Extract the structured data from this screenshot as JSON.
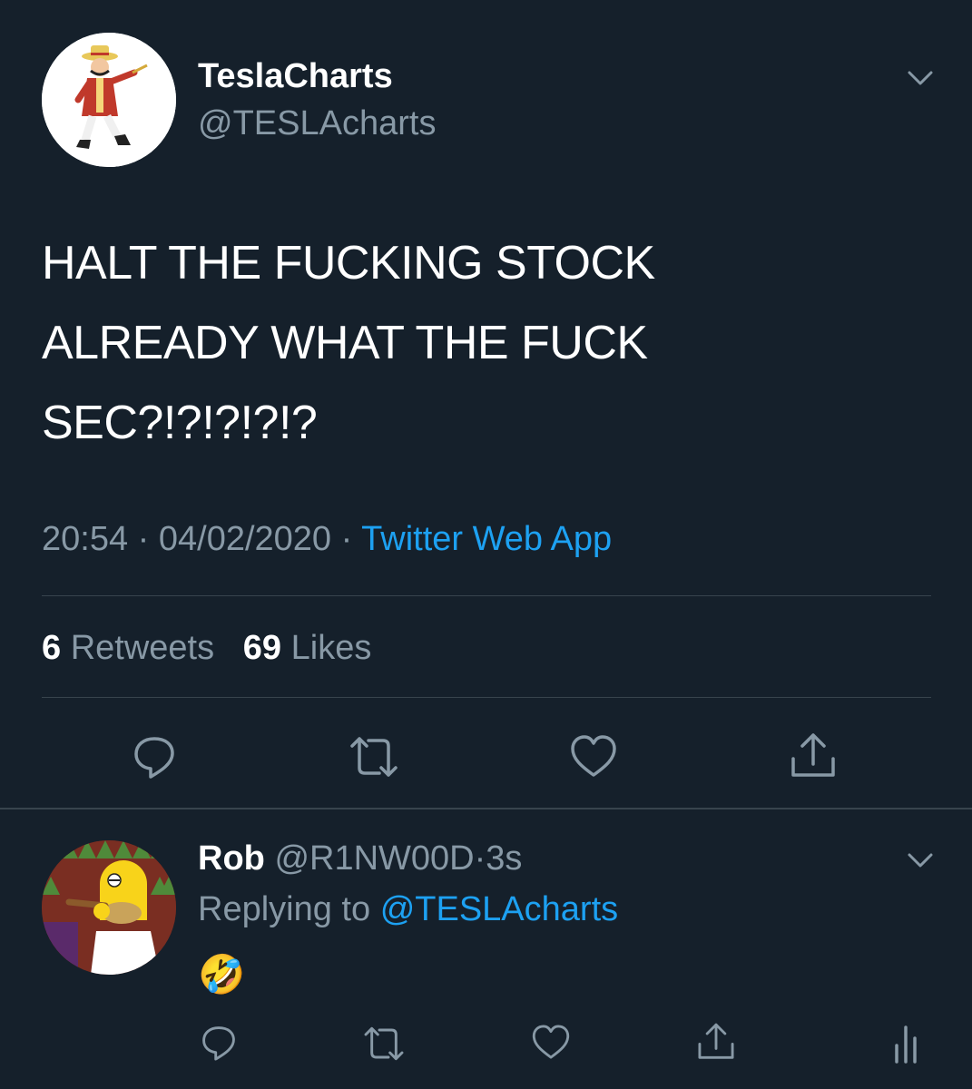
{
  "tweet": {
    "display_name": "TeslaCharts",
    "handle": "@TESLAcharts",
    "text": "HALT THE FUCKING STOCK\nALREADY WHAT THE FUCK\nSEC?!?!?!?!?",
    "time": "20:54",
    "date": "04/02/2020",
    "separator": "·",
    "source": "Twitter Web App",
    "retweets_count": "6",
    "retweets_label": "Retweets",
    "likes_count": "69",
    "likes_label": "Likes"
  },
  "reply": {
    "display_name": "Rob",
    "handle": "@R1NW00D",
    "separator": "·",
    "time_ago": "3s",
    "replying_prefix": "Replying to",
    "replying_to": "@TESLAcharts",
    "text": "🤣"
  },
  "icons": {
    "reply": "reply-icon",
    "retweet": "retweet-icon",
    "like": "heart-icon",
    "share": "share-icon",
    "analytics": "analytics-icon",
    "more": "chevron-down-icon"
  },
  "colors": {
    "background": "#15202b",
    "text": "#ffffff",
    "secondary": "#8899a6",
    "accent": "#1da1f2",
    "divider": "#38444d"
  }
}
